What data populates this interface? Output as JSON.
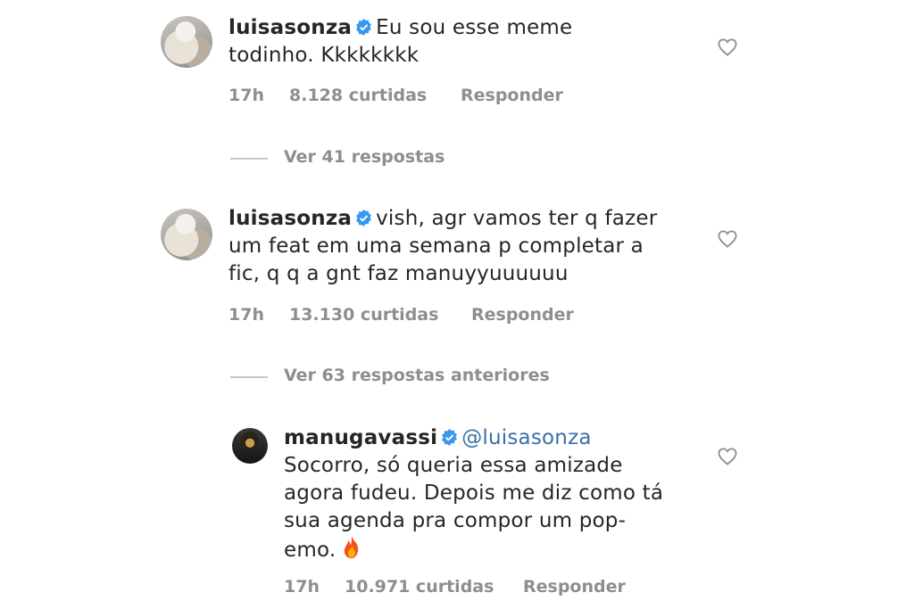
{
  "comments": [
    {
      "username": "luisasonza",
      "line1": "Eu sou esse meme",
      "line2": "todinho. Kkkkkkkk",
      "time": "17h",
      "likes": "8.128 curtidas",
      "reply": "Responder"
    },
    {
      "username": "luisasonza",
      "line1": "vish, agr vamos ter q fazer",
      "line2": "um feat em uma semana p completar a",
      "line3": "fic, q q a gnt faz manuyyuuuuuu",
      "time": "17h",
      "likes": "13.130 curtidas",
      "reply": "Responder"
    },
    {
      "username": "manugavassi",
      "mention": "@luisasonza",
      "line2": "Socorro, só queria essa amizade",
      "line3": "agora fudeu. Depois me diz como tá",
      "line4": "sua agenda pra compor um pop-",
      "line5": "emo.",
      "time": "17h",
      "likes": "10.971 curtidas",
      "reply": "Responder"
    }
  ],
  "view_replies_1": "Ver 41 respostas",
  "view_replies_2": "Ver 63 respostas anteriores",
  "colors": {
    "verified": "#3897f0",
    "mention": "#3a6fa8",
    "meta": "#8e8e8e"
  },
  "icons": [
    "verified-badge-icon",
    "heart-icon",
    "fire-emoji-icon"
  ]
}
